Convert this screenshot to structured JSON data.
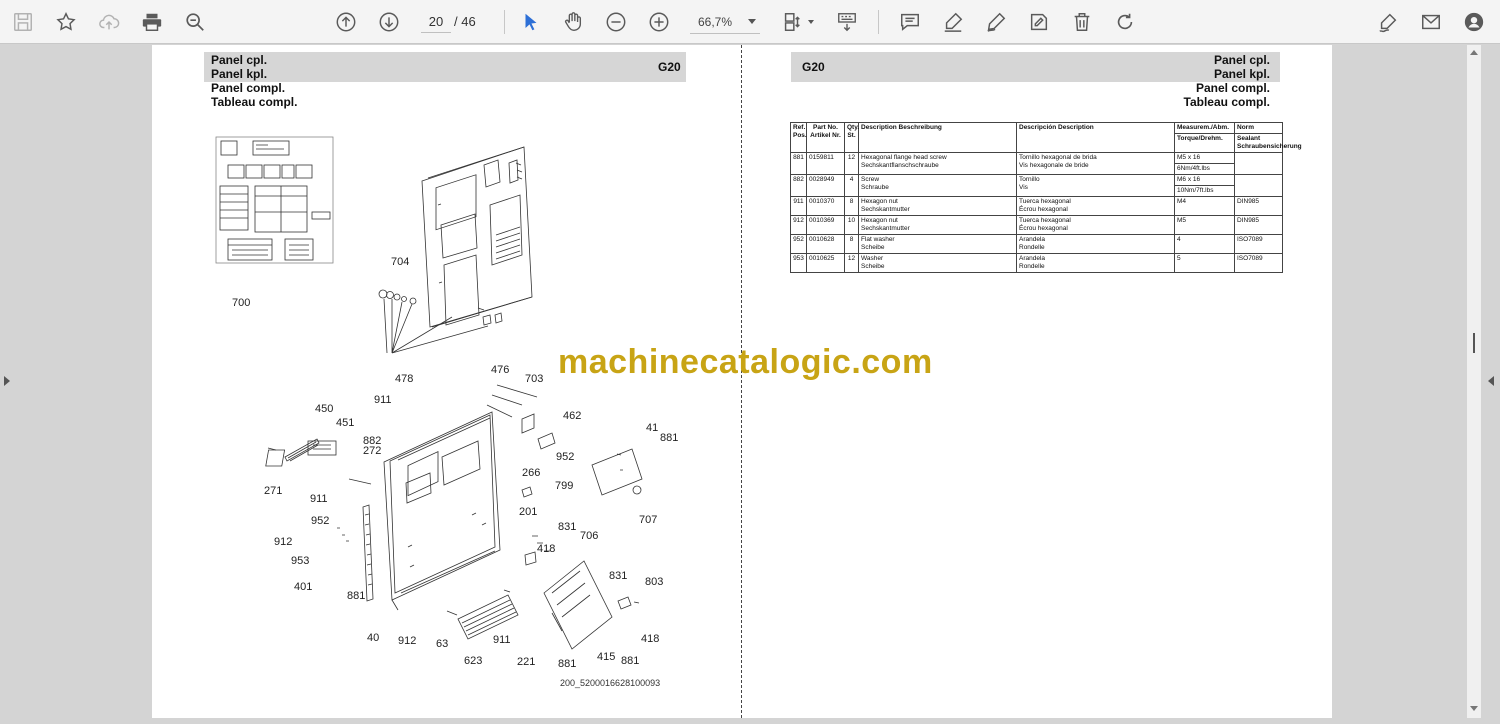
{
  "toolbar": {
    "current_page": "20",
    "total_pages": "/ 46",
    "zoom": "66,7%"
  },
  "page": {
    "header_left": [
      "Panel cpl.",
      "Panel kpl.",
      "Panel compl.",
      "Tableau compl."
    ],
    "header_right": [
      "Panel cpl.",
      "Panel kpl.",
      "Panel compl.",
      "Tableau compl."
    ],
    "section_code": "G20"
  },
  "watermark": "machinecatalogic.com",
  "diagram": {
    "id": "200_5200016628100093",
    "callouts": [
      "700",
      "704",
      "478",
      "476",
      "703",
      "911",
      "450",
      "451",
      "882",
      "272",
      "462",
      "41",
      "881",
      "952",
      "266",
      "799",
      "271",
      "911",
      "201",
      "707",
      "952",
      "831",
      "706",
      "418",
      "912",
      "953",
      "401",
      "881",
      "831",
      "803",
      "40",
      "912",
      "63",
      "911",
      "418",
      "623",
      "221",
      "881",
      "415",
      "881"
    ]
  },
  "table": {
    "headers": {
      "pos": "Ref. Pos.",
      "part": "Part No. Artikel Nr.",
      "qty": "Qty. St.",
      "desc": "Description Beschreibung",
      "desc_es": "Descripción Description",
      "measure": "Measurem./Abm.",
      "torque": "Torque/Drehm.",
      "norm": "Norm",
      "sealant": "Sealant Schraubensicherung"
    },
    "rows": [
      {
        "pos": "881",
        "part": "0159811",
        "qty": "12",
        "desc": "Hexagonal flange head screw",
        "desc_de": "Sechskantflanschschraube",
        "desc_es": "Tornillo hexagonal de brida",
        "desc_fr": "Vis hexagonale de bride",
        "measure": "M5 x 16",
        "torque": "6Nm/4ft.lbs",
        "norm": ""
      },
      {
        "pos": "882",
        "part": "0028949",
        "qty": "4",
        "desc": "Screw",
        "desc_de": "Schraube",
        "desc_es": "Tornillo",
        "desc_fr": "Vis",
        "measure": "M6 x 16",
        "torque": "10Nm/7ft.lbs",
        "norm": ""
      },
      {
        "pos": "911",
        "part": "0010370",
        "qty": "8",
        "desc": "Hexagon nut",
        "desc_de": "Sechskantmutter",
        "desc_es": "Tuerca hexagonal",
        "desc_fr": "Écrou hexagonal",
        "measure": "M4",
        "torque": "",
        "norm": "DIN985"
      },
      {
        "pos": "912",
        "part": "0010369",
        "qty": "10",
        "desc": "Hexagon nut",
        "desc_de": "Sechskantmutter",
        "desc_es": "Tuerca hexagonal",
        "desc_fr": "Écrou hexagonal",
        "measure": "M5",
        "torque": "",
        "norm": "DIN985"
      },
      {
        "pos": "952",
        "part": "0010628",
        "qty": "8",
        "desc": "Flat washer",
        "desc_de": "Scheibe",
        "desc_es": "Arandela",
        "desc_fr": "Rondelle",
        "measure": "4",
        "torque": "",
        "norm": "ISO7089"
      },
      {
        "pos": "953",
        "part": "0010625",
        "qty": "12",
        "desc": "Washer",
        "desc_de": "Scheibe",
        "desc_es": "Arandela",
        "desc_fr": "Rondelle",
        "measure": "5",
        "torque": "",
        "norm": "ISO7089"
      }
    ]
  }
}
